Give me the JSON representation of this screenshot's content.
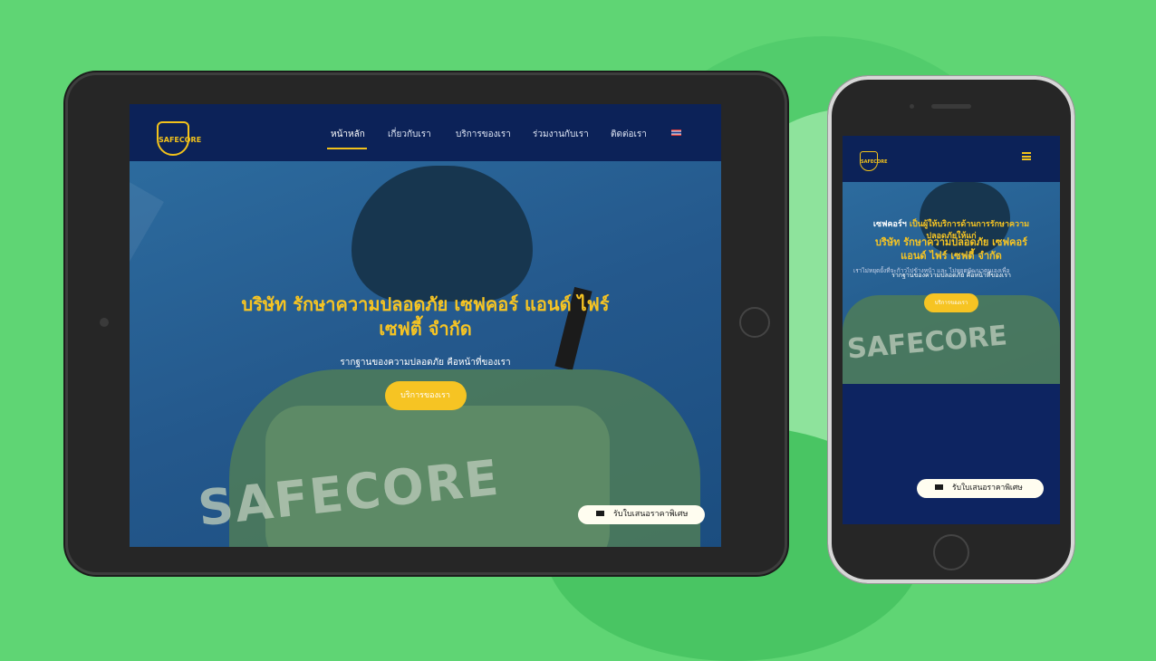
{
  "colors": {
    "background": "#5fd574",
    "header": "#0c2258",
    "accent": "#f6c423"
  },
  "brand": {
    "logo_text": "SAFECORE"
  },
  "nav": {
    "items": [
      "หน้าหลัก",
      "เกี่ยวกับเรา",
      "บริการของเรา",
      "ร่วมงานกับเรา",
      "ติดต่อเรา"
    ],
    "active": "หน้าหลัก",
    "language_icon": "thai-flag-icon"
  },
  "hero": {
    "title_line1": "บริษัท รักษาความปลอดภัย เซฟคอร์ แอนด์ ไฟร์",
    "title_line2": "เซฟตี้ จำกัด",
    "subtitle": "รากฐานของความปลอดภัย คือหน้าที่ของเรา",
    "cta_label": "บริการของเรา",
    "background_text": "SAFECORE"
  },
  "quote_button": {
    "label": "รับใบเสนอราคาพิเศษ",
    "icon": "envelope-icon"
  },
  "mobile": {
    "menu_icon": "hamburger-menu-icon",
    "hero_title_line1": "บริษัท รักษาความปลอดภัย เซฟคอร์",
    "hero_title_line2": "แอนด์ ไฟร์ เซฟตี้ จำกัด",
    "about_title_prefix": "เซฟคอร์ฯ",
    "about_title_line1_rest": "เป็นผู้ให้บริการด้านการรักษาความ",
    "about_title_line2": "ปลอดภัยให้แก่",
    "about_body": "เราไม่หยุดยั้งที่จะก้าวไปข้างหน้า และ ไม่หยุดพัฒนาตนเองเพื่อ"
  }
}
